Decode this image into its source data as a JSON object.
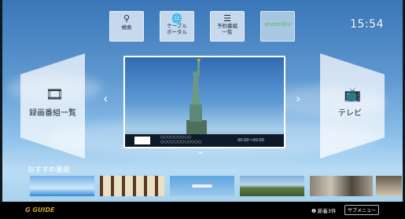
{
  "toolbar": {
    "search": {
      "label": "検索",
      "icon": "search-icon"
    },
    "cable_portal": {
      "label": "ケーブル\nポータル",
      "icon": "globe-icon"
    },
    "reservation_list": {
      "label": "予約番組\n一覧",
      "icon": "list-clock-icon"
    },
    "android_tv": {
      "label": "androidtv"
    }
  },
  "clock": "15:54",
  "left_panel": {
    "label": "録画番組一覧",
    "icon": "film-icon"
  },
  "right_panel": {
    "label": "テレビ",
    "icon": "tv-icon"
  },
  "preview": {
    "title_placeholder": "○○○○○○○○○",
    "subtitle_placeholder": "○○○○○○○○○○○○",
    "time": "00:00～00:00"
  },
  "recommendations": {
    "title": "おすすめ番組",
    "items": [
      {
        "name": "beach-city",
        "colors": [
          "#6fb2e8",
          "#cfe8f7",
          "#2e8ad8"
        ]
      },
      {
        "name": "japanese-room",
        "colors": [
          "#c8b58f",
          "#5a3a1f",
          "#eae0c8"
        ]
      },
      {
        "name": "airplane",
        "colors": [
          "#5ea6e0",
          "#9bc8ee",
          "#3e84c4"
        ]
      },
      {
        "name": "statue-park",
        "colors": [
          "#7fb0dc",
          "#5c7a46",
          "#b8d6ec"
        ]
      },
      {
        "name": "cats",
        "colors": [
          "#8a8276",
          "#c9c2b5",
          "#4d463d"
        ]
      },
      {
        "name": "dog",
        "colors": [
          "#6a5c4c",
          "#d0c6b4",
          "#a08a6a"
        ]
      }
    ]
  },
  "bottombar": {
    "logo": "G GUIDE",
    "new_info": "新着3件",
    "submenu": "サブメニュー"
  }
}
